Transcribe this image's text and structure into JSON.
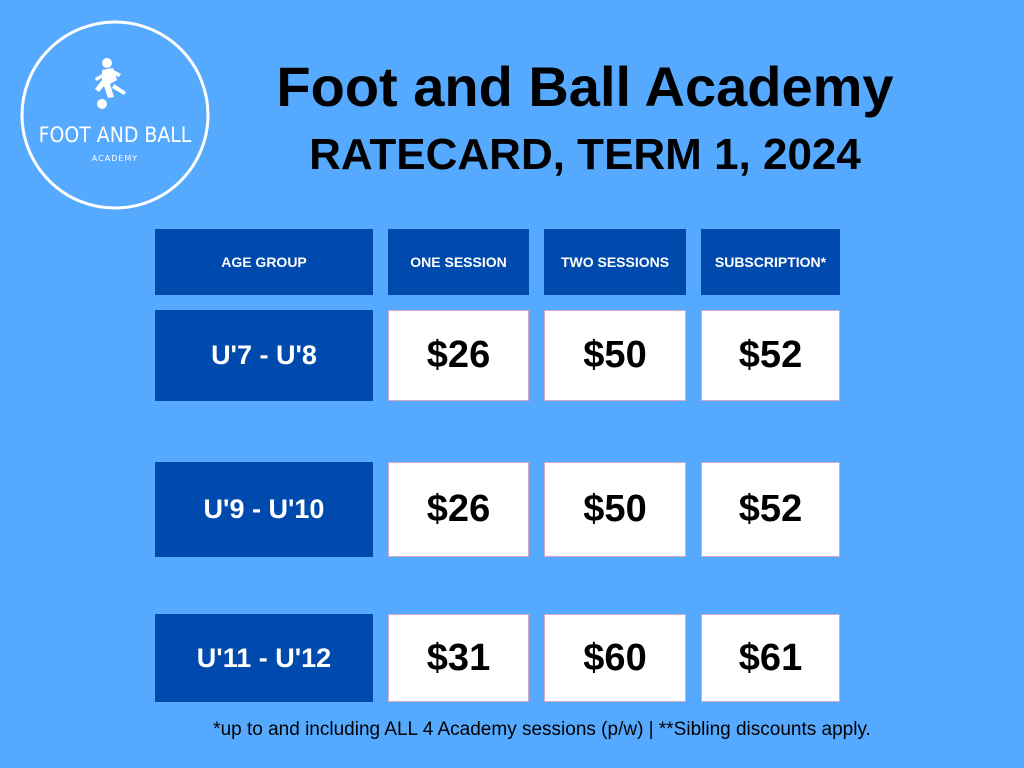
{
  "logo": {
    "name": "FOOT AND BALL",
    "sub": "ACADEMY"
  },
  "title": "Foot and Ball Academy",
  "subtitle": "RATECARD, TERM 1, 2024",
  "table": {
    "headers": [
      "AGE GROUP",
      "ONE SESSION",
      "TWO SESSIONS",
      "SUBSCRIPTION*"
    ],
    "rows": [
      {
        "age": "U'7 - U'8",
        "prices": [
          "$26",
          "$50",
          "$52"
        ]
      },
      {
        "age": "U'9 - U'10",
        "prices": [
          "$26",
          "$50",
          "$52"
        ]
      },
      {
        "age": "U'11 - U'12",
        "prices": [
          "$31",
          "$60",
          "$61"
        ]
      }
    ]
  },
  "footnote": "*up to and including ALL 4  Academy sessions (p/w) | **Sibling discounts apply.",
  "colors": {
    "background": "#55aaff",
    "header_fill": "#004aad",
    "price_fill": "#ffffff"
  }
}
